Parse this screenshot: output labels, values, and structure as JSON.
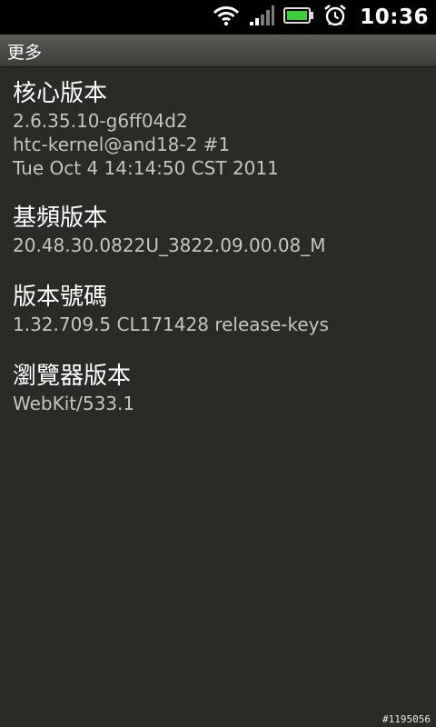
{
  "status_bar": {
    "time": "10:36",
    "icons": [
      "wifi-icon",
      "signal-icon",
      "battery-icon",
      "alarm-icon"
    ],
    "battery_color": "#3ad13a"
  },
  "title_bar": {
    "title": "更多"
  },
  "items": [
    {
      "title": "核心版本",
      "lines": [
        "2.6.35.10-g6ff04d2",
        "htc-kernel@and18-2 #1",
        "Tue Oct 4 14:14:50 CST 2011"
      ]
    },
    {
      "title": "基頻版本",
      "lines": [
        "20.48.30.0822U_3822.09.00.08_M"
      ]
    },
    {
      "title": "版本號碼",
      "lines": [
        "1.32.709.5 CL171428 release-keys"
      ]
    },
    {
      "title": "瀏覽器版本",
      "lines": [
        "WebKit/533.1"
      ]
    }
  ],
  "watermark": "#1195056"
}
